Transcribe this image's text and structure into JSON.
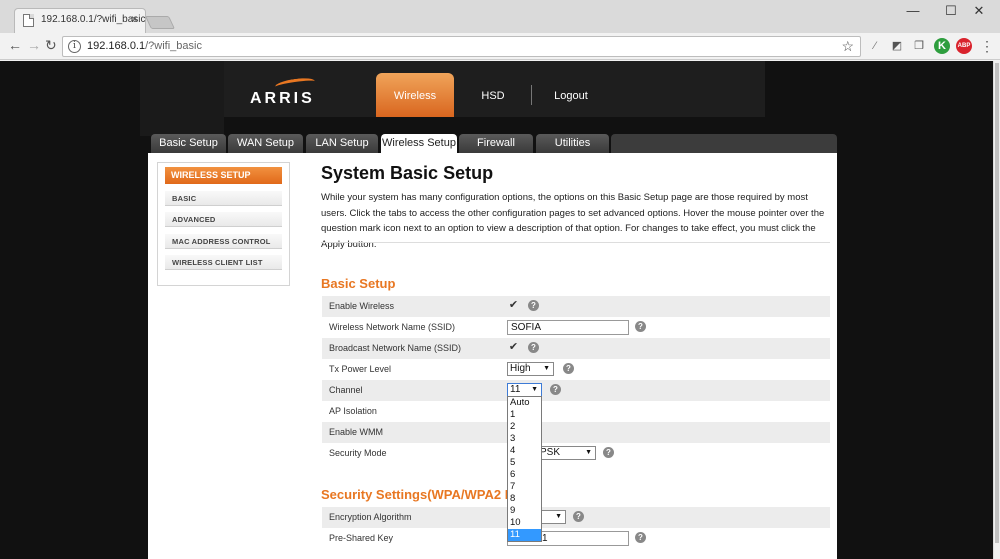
{
  "browser": {
    "tab_title": "192.168.0.1/?wifi_basic",
    "tab_close": "×",
    "url_host": "192.168.0.1",
    "url_path": "/?wifi_basic",
    "window_controls": {
      "minimize": "—",
      "maximize": "☐",
      "close": "✕"
    },
    "nav_icons": [
      "back-icon",
      "forward-icon",
      "reload-icon"
    ],
    "extensions": [
      {
        "name": "pen-icon",
        "glyph": "⁄"
      },
      {
        "name": "cast-icon",
        "glyph": "◩"
      },
      {
        "name": "copy-icon",
        "glyph": "❐"
      },
      {
        "name": "k-extension-icon",
        "glyph": "K",
        "color": "#2e9e3e"
      },
      {
        "name": "adblock-icon",
        "glyph": "ABP",
        "color": "#d9232d"
      },
      {
        "name": "menu-icon",
        "glyph": "⋮"
      }
    ]
  },
  "header": {
    "logo": "ARRIS",
    "nav": [
      {
        "label": "Wireless",
        "active": true
      },
      {
        "label": "HSD",
        "active": false
      },
      {
        "label": "Logout",
        "active": false
      }
    ]
  },
  "subtabs": [
    {
      "label": "Basic Setup",
      "active": false
    },
    {
      "label": "WAN Setup",
      "active": false
    },
    {
      "label": "LAN Setup",
      "active": false
    },
    {
      "label": "Wireless Setup",
      "active": true
    },
    {
      "label": "Firewall",
      "active": false
    },
    {
      "label": "Utilities",
      "active": false
    }
  ],
  "sidebar": {
    "heading": "WIRELESS SETUP",
    "items": [
      "BASIC",
      "ADVANCED",
      "MAC ADDRESS CONTROL",
      "WIRELESS CLIENT LIST"
    ]
  },
  "main": {
    "title": "System Basic Setup",
    "intro": "While your system has many configuration options, the options on this Basic Setup page are those required by most users. Click the tabs to access the other configuration pages to set advanced options. Hover the mouse pointer over the question mark icon next to an option to view a description of that option. For changes to take effect, you must click the Apply button.",
    "basic_setup": {
      "title": "Basic Setup",
      "rows": [
        {
          "label": "Enable Wireless",
          "type": "checkbox",
          "checked": true
        },
        {
          "label": "Wireless Network Name (SSID)",
          "type": "text",
          "value": "SOFIA"
        },
        {
          "label": "Broadcast Network Name (SSID)",
          "type": "checkbox",
          "checked": true
        },
        {
          "label": "Tx Power Level",
          "type": "select",
          "value": "High"
        },
        {
          "label": "Channel",
          "type": "select",
          "value": "11"
        },
        {
          "label": "AP Isolation",
          "type": "checkbox"
        },
        {
          "label": "Enable WMM",
          "type": "checkbox"
        },
        {
          "label": "Security Mode",
          "type": "select",
          "value_visible": "PSK"
        }
      ]
    },
    "security_settings": {
      "title": "Security Settings(WPA/WPA2 P",
      "rows": [
        {
          "label": "Encryption Algorithm",
          "type": "select"
        },
        {
          "label": "Pre-Shared Key",
          "type": "text",
          "value_visible": "1"
        }
      ]
    },
    "channel_dropdown": {
      "options": [
        "Auto",
        "1",
        "2",
        "3",
        "4",
        "5",
        "6",
        "7",
        "8",
        "9",
        "10",
        "11"
      ],
      "selected": "11"
    },
    "help_glyph": "?",
    "check_glyph": "✔",
    "select_arrow": "▼"
  }
}
